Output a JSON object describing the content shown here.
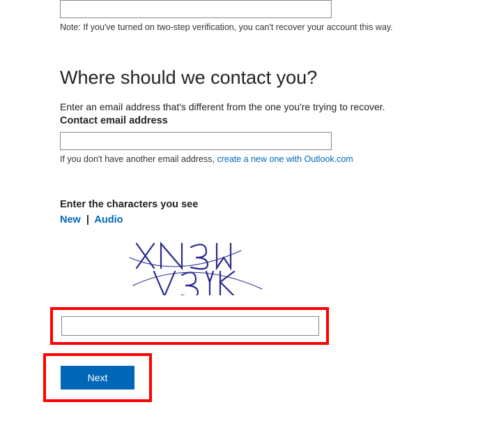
{
  "note": "Note: If you've turned on two-step verification, you can't recover your account this way.",
  "heading": "Where should we contact you?",
  "instruction": "Enter an email address that's different from the one you're trying to recover.",
  "contactLabel": "Contact email address",
  "helpPrefix": "If you don't have another email address, ",
  "helpLink": "create a new one with Outlook.com",
  "captchaLabel": "Enter the characters you see",
  "newLink": "New",
  "separator": "|",
  "audioLink": "Audio",
  "nextLabel": "Next"
}
